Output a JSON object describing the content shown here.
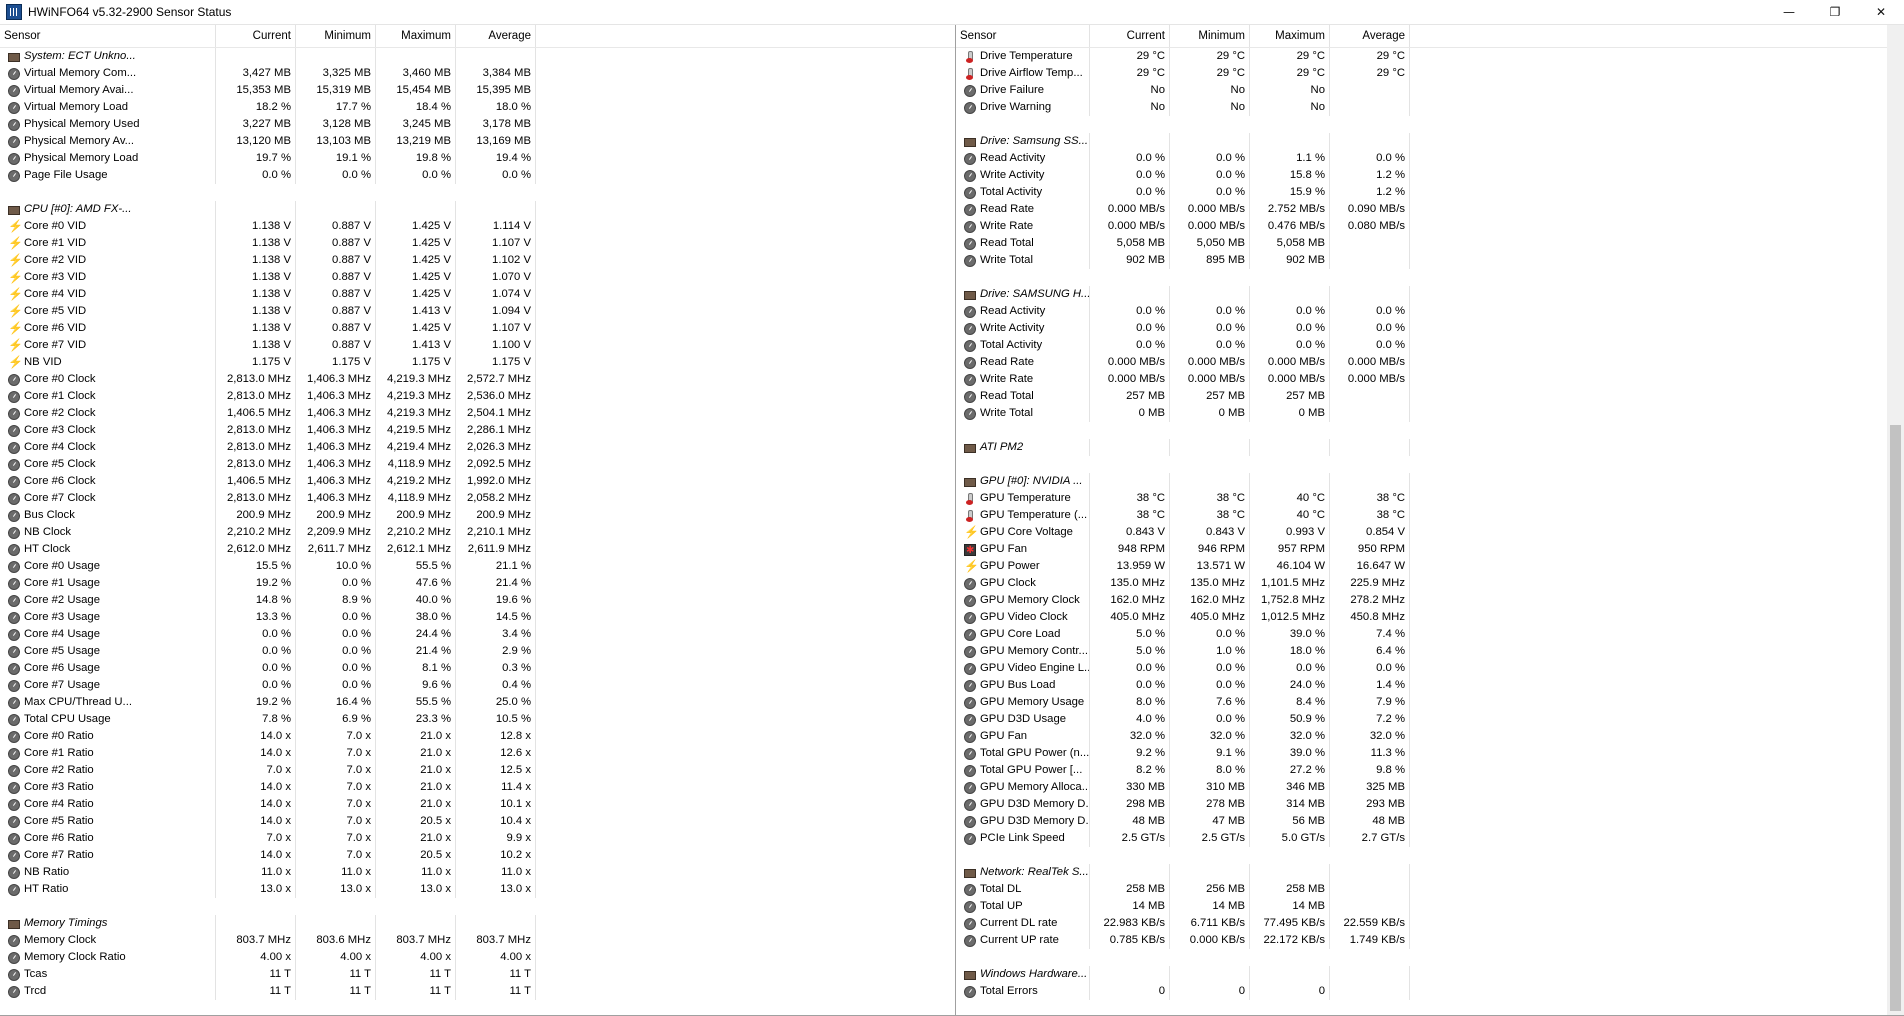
{
  "window": {
    "title": "HWiNFO64 v5.32-2900 Sensor Status",
    "controls": [
      "—",
      "❐",
      "✕"
    ]
  },
  "columns": [
    "Sensor",
    "Current",
    "Minimum",
    "Maximum",
    "Average"
  ],
  "left": [
    {
      "type": "group",
      "name": "System: ECT Unkno...",
      "icon": "chip-icon"
    },
    {
      "type": "row",
      "name": "Virtual Memory Com...",
      "icon": "gauge-icon",
      "v": [
        "3,427 MB",
        "3,325 MB",
        "3,460 MB",
        "3,384 MB"
      ]
    },
    {
      "type": "row",
      "name": "Virtual Memory Avai...",
      "icon": "gauge-icon",
      "v": [
        "15,353 MB",
        "15,319 MB",
        "15,454 MB",
        "15,395 MB"
      ]
    },
    {
      "type": "row",
      "name": "Virtual Memory Load",
      "icon": "gauge-icon",
      "v": [
        "18.2 %",
        "17.7 %",
        "18.4 %",
        "18.0 %"
      ]
    },
    {
      "type": "row",
      "name": "Physical Memory Used",
      "icon": "gauge-icon",
      "v": [
        "3,227 MB",
        "3,128 MB",
        "3,245 MB",
        "3,178 MB"
      ]
    },
    {
      "type": "row",
      "name": "Physical Memory Av...",
      "icon": "gauge-icon",
      "v": [
        "13,120 MB",
        "13,103 MB",
        "13,219 MB",
        "13,169 MB"
      ]
    },
    {
      "type": "row",
      "name": "Physical Memory Load",
      "icon": "gauge-icon",
      "v": [
        "19.7 %",
        "19.1 %",
        "19.8 %",
        "19.4 %"
      ]
    },
    {
      "type": "row",
      "name": "Page File Usage",
      "icon": "gauge-icon",
      "v": [
        "0.0 %",
        "0.0 %",
        "0.0 %",
        "0.0 %"
      ]
    },
    {
      "type": "blank"
    },
    {
      "type": "group",
      "name": "CPU [#0]: AMD FX-...",
      "icon": "chip-icon"
    },
    {
      "type": "row",
      "name": "Core #0 VID",
      "icon": "volt-icon",
      "v": [
        "1.138 V",
        "0.887 V",
        "1.425 V",
        "1.114 V"
      ]
    },
    {
      "type": "row",
      "name": "Core #1 VID",
      "icon": "volt-icon",
      "v": [
        "1.138 V",
        "0.887 V",
        "1.425 V",
        "1.107 V"
      ]
    },
    {
      "type": "row",
      "name": "Core #2 VID",
      "icon": "volt-icon",
      "v": [
        "1.138 V",
        "0.887 V",
        "1.425 V",
        "1.102 V"
      ]
    },
    {
      "type": "row",
      "name": "Core #3 VID",
      "icon": "volt-icon",
      "v": [
        "1.138 V",
        "0.887 V",
        "1.425 V",
        "1.070 V"
      ]
    },
    {
      "type": "row",
      "name": "Core #4 VID",
      "icon": "volt-icon",
      "v": [
        "1.138 V",
        "0.887 V",
        "1.425 V",
        "1.074 V"
      ]
    },
    {
      "type": "row",
      "name": "Core #5 VID",
      "icon": "volt-icon",
      "v": [
        "1.138 V",
        "0.887 V",
        "1.413 V",
        "1.094 V"
      ]
    },
    {
      "type": "row",
      "name": "Core #6 VID",
      "icon": "volt-icon",
      "v": [
        "1.138 V",
        "0.887 V",
        "1.425 V",
        "1.107 V"
      ]
    },
    {
      "type": "row",
      "name": "Core #7 VID",
      "icon": "volt-icon",
      "v": [
        "1.138 V",
        "0.887 V",
        "1.413 V",
        "1.100 V"
      ]
    },
    {
      "type": "row",
      "name": "NB VID",
      "icon": "volt-icon",
      "v": [
        "1.175 V",
        "1.175 V",
        "1.175 V",
        "1.175 V"
      ]
    },
    {
      "type": "row",
      "name": "Core #0 Clock",
      "icon": "gauge-icon",
      "v": [
        "2,813.0 MHz",
        "1,406.3 MHz",
        "4,219.3 MHz",
        "2,572.7 MHz"
      ]
    },
    {
      "type": "row",
      "name": "Core #1 Clock",
      "icon": "gauge-icon",
      "v": [
        "2,813.0 MHz",
        "1,406.3 MHz",
        "4,219.3 MHz",
        "2,536.0 MHz"
      ]
    },
    {
      "type": "row",
      "name": "Core #2 Clock",
      "icon": "gauge-icon",
      "v": [
        "1,406.5 MHz",
        "1,406.3 MHz",
        "4,219.3 MHz",
        "2,504.1 MHz"
      ]
    },
    {
      "type": "row",
      "name": "Core #3 Clock",
      "icon": "gauge-icon",
      "v": [
        "2,813.0 MHz",
        "1,406.3 MHz",
        "4,219.5 MHz",
        "2,286.1 MHz"
      ]
    },
    {
      "type": "row",
      "name": "Core #4 Clock",
      "icon": "gauge-icon",
      "v": [
        "2,813.0 MHz",
        "1,406.3 MHz",
        "4,219.4 MHz",
        "2,026.3 MHz"
      ]
    },
    {
      "type": "row",
      "name": "Core #5 Clock",
      "icon": "gauge-icon",
      "v": [
        "2,813.0 MHz",
        "1,406.3 MHz",
        "4,118.9 MHz",
        "2,092.5 MHz"
      ]
    },
    {
      "type": "row",
      "name": "Core #6 Clock",
      "icon": "gauge-icon",
      "v": [
        "1,406.5 MHz",
        "1,406.3 MHz",
        "4,219.2 MHz",
        "1,992.0 MHz"
      ]
    },
    {
      "type": "row",
      "name": "Core #7 Clock",
      "icon": "gauge-icon",
      "v": [
        "2,813.0 MHz",
        "1,406.3 MHz",
        "4,118.9 MHz",
        "2,058.2 MHz"
      ]
    },
    {
      "type": "row",
      "name": "Bus Clock",
      "icon": "gauge-icon",
      "v": [
        "200.9 MHz",
        "200.9 MHz",
        "200.9 MHz",
        "200.9 MHz"
      ]
    },
    {
      "type": "row",
      "name": "NB Clock",
      "icon": "gauge-icon",
      "v": [
        "2,210.2 MHz",
        "2,209.9 MHz",
        "2,210.2 MHz",
        "2,210.1 MHz"
      ]
    },
    {
      "type": "row",
      "name": "HT Clock",
      "icon": "gauge-icon",
      "v": [
        "2,612.0 MHz",
        "2,611.7 MHz",
        "2,612.1 MHz",
        "2,611.9 MHz"
      ]
    },
    {
      "type": "row",
      "name": "Core #0 Usage",
      "icon": "gauge-icon",
      "v": [
        "15.5 %",
        "10.0 %",
        "55.5 %",
        "21.1 %"
      ]
    },
    {
      "type": "row",
      "name": "Core #1 Usage",
      "icon": "gauge-icon",
      "v": [
        "19.2 %",
        "0.0 %",
        "47.6 %",
        "21.4 %"
      ]
    },
    {
      "type": "row",
      "name": "Core #2 Usage",
      "icon": "gauge-icon",
      "v": [
        "14.8 %",
        "8.9 %",
        "40.0 %",
        "19.6 %"
      ]
    },
    {
      "type": "row",
      "name": "Core #3 Usage",
      "icon": "gauge-icon",
      "v": [
        "13.3 %",
        "0.0 %",
        "38.0 %",
        "14.5 %"
      ]
    },
    {
      "type": "row",
      "name": "Core #4 Usage",
      "icon": "gauge-icon",
      "v": [
        "0.0 %",
        "0.0 %",
        "24.4 %",
        "3.4 %"
      ]
    },
    {
      "type": "row",
      "name": "Core #5 Usage",
      "icon": "gauge-icon",
      "v": [
        "0.0 %",
        "0.0 %",
        "21.4 %",
        "2.9 %"
      ]
    },
    {
      "type": "row",
      "name": "Core #6 Usage",
      "icon": "gauge-icon",
      "v": [
        "0.0 %",
        "0.0 %",
        "8.1 %",
        "0.3 %"
      ]
    },
    {
      "type": "row",
      "name": "Core #7 Usage",
      "icon": "gauge-icon",
      "v": [
        "0.0 %",
        "0.0 %",
        "9.6 %",
        "0.4 %"
      ]
    },
    {
      "type": "row",
      "name": "Max CPU/Thread U...",
      "icon": "gauge-icon",
      "v": [
        "19.2 %",
        "16.4 %",
        "55.5 %",
        "25.0 %"
      ]
    },
    {
      "type": "row",
      "name": "Total CPU Usage",
      "icon": "gauge-icon",
      "v": [
        "7.8 %",
        "6.9 %",
        "23.3 %",
        "10.5 %"
      ]
    },
    {
      "type": "row",
      "name": "Core #0 Ratio",
      "icon": "gauge-icon",
      "v": [
        "14.0 x",
        "7.0 x",
        "21.0 x",
        "12.8 x"
      ]
    },
    {
      "type": "row",
      "name": "Core #1 Ratio",
      "icon": "gauge-icon",
      "v": [
        "14.0 x",
        "7.0 x",
        "21.0 x",
        "12.6 x"
      ]
    },
    {
      "type": "row",
      "name": "Core #2 Ratio",
      "icon": "gauge-icon",
      "v": [
        "7.0 x",
        "7.0 x",
        "21.0 x",
        "12.5 x"
      ]
    },
    {
      "type": "row",
      "name": "Core #3 Ratio",
      "icon": "gauge-icon",
      "v": [
        "14.0 x",
        "7.0 x",
        "21.0 x",
        "11.4 x"
      ]
    },
    {
      "type": "row",
      "name": "Core #4 Ratio",
      "icon": "gauge-icon",
      "v": [
        "14.0 x",
        "7.0 x",
        "21.0 x",
        "10.1 x"
      ]
    },
    {
      "type": "row",
      "name": "Core #5 Ratio",
      "icon": "gauge-icon",
      "v": [
        "14.0 x",
        "7.0 x",
        "20.5 x",
        "10.4 x"
      ]
    },
    {
      "type": "row",
      "name": "Core #6 Ratio",
      "icon": "gauge-icon",
      "v": [
        "7.0 x",
        "7.0 x",
        "21.0 x",
        "9.9 x"
      ]
    },
    {
      "type": "row",
      "name": "Core #7 Ratio",
      "icon": "gauge-icon",
      "v": [
        "14.0 x",
        "7.0 x",
        "20.5 x",
        "10.2 x"
      ]
    },
    {
      "type": "row",
      "name": "NB Ratio",
      "icon": "gauge-icon",
      "v": [
        "11.0 x",
        "11.0 x",
        "11.0 x",
        "11.0 x"
      ]
    },
    {
      "type": "row",
      "name": "HT Ratio",
      "icon": "gauge-icon",
      "v": [
        "13.0 x",
        "13.0 x",
        "13.0 x",
        "13.0 x"
      ]
    },
    {
      "type": "blank"
    },
    {
      "type": "group",
      "name": "Memory Timings",
      "icon": "chip-icon"
    },
    {
      "type": "row",
      "name": "Memory Clock",
      "icon": "gauge-icon",
      "v": [
        "803.7 MHz",
        "803.6 MHz",
        "803.7 MHz",
        "803.7 MHz"
      ]
    },
    {
      "type": "row",
      "name": "Memory Clock Ratio",
      "icon": "gauge-icon",
      "v": [
        "4.00 x",
        "4.00 x",
        "4.00 x",
        "4.00 x"
      ]
    },
    {
      "type": "row",
      "name": "Tcas",
      "icon": "gauge-icon",
      "v": [
        "11 T",
        "11 T",
        "11 T",
        "11 T"
      ]
    },
    {
      "type": "row",
      "name": "Trcd",
      "icon": "gauge-icon",
      "v": [
        "11 T",
        "11 T",
        "11 T",
        "11 T"
      ]
    }
  ],
  "right": [
    {
      "type": "row",
      "name": "Drive Temperature",
      "icon": "temp-icon",
      "v": [
        "29 °C",
        "29 °C",
        "29 °C",
        "29 °C"
      ]
    },
    {
      "type": "row",
      "name": "Drive Airflow Temp...",
      "icon": "temp-icon",
      "v": [
        "29 °C",
        "29 °C",
        "29 °C",
        "29 °C"
      ]
    },
    {
      "type": "row",
      "name": "Drive Failure",
      "icon": "gauge-icon",
      "v": [
        "No",
        "No",
        "No",
        ""
      ]
    },
    {
      "type": "row",
      "name": "Drive Warning",
      "icon": "gauge-icon",
      "v": [
        "No",
        "No",
        "No",
        ""
      ]
    },
    {
      "type": "blank"
    },
    {
      "type": "group",
      "name": "Drive: Samsung SS...",
      "icon": "chip-icon"
    },
    {
      "type": "row",
      "name": "Read Activity",
      "icon": "gauge-icon",
      "v": [
        "0.0 %",
        "0.0 %",
        "1.1 %",
        "0.0 %"
      ]
    },
    {
      "type": "row",
      "name": "Write Activity",
      "icon": "gauge-icon",
      "v": [
        "0.0 %",
        "0.0 %",
        "15.8 %",
        "1.2 %"
      ]
    },
    {
      "type": "row",
      "name": "Total Activity",
      "icon": "gauge-icon",
      "v": [
        "0.0 %",
        "0.0 %",
        "15.9 %",
        "1.2 %"
      ]
    },
    {
      "type": "row",
      "name": "Read Rate",
      "icon": "gauge-icon",
      "v": [
        "0.000 MB/s",
        "0.000 MB/s",
        "2.752 MB/s",
        "0.090 MB/s"
      ]
    },
    {
      "type": "row",
      "name": "Write Rate",
      "icon": "gauge-icon",
      "v": [
        "0.000 MB/s",
        "0.000 MB/s",
        "0.476 MB/s",
        "0.080 MB/s"
      ]
    },
    {
      "type": "row",
      "name": "Read Total",
      "icon": "gauge-icon",
      "v": [
        "5,058 MB",
        "5,050 MB",
        "5,058 MB",
        ""
      ]
    },
    {
      "type": "row",
      "name": "Write Total",
      "icon": "gauge-icon",
      "v": [
        "902 MB",
        "895 MB",
        "902 MB",
        ""
      ]
    },
    {
      "type": "blank"
    },
    {
      "type": "group",
      "name": "Drive: SAMSUNG H...",
      "icon": "chip-icon"
    },
    {
      "type": "row",
      "name": "Read Activity",
      "icon": "gauge-icon",
      "v": [
        "0.0 %",
        "0.0 %",
        "0.0 %",
        "0.0 %"
      ]
    },
    {
      "type": "row",
      "name": "Write Activity",
      "icon": "gauge-icon",
      "v": [
        "0.0 %",
        "0.0 %",
        "0.0 %",
        "0.0 %"
      ]
    },
    {
      "type": "row",
      "name": "Total Activity",
      "icon": "gauge-icon",
      "v": [
        "0.0 %",
        "0.0 %",
        "0.0 %",
        "0.0 %"
      ]
    },
    {
      "type": "row",
      "name": "Read Rate",
      "icon": "gauge-icon",
      "v": [
        "0.000 MB/s",
        "0.000 MB/s",
        "0.000 MB/s",
        "0.000 MB/s"
      ]
    },
    {
      "type": "row",
      "name": "Write Rate",
      "icon": "gauge-icon",
      "v": [
        "0.000 MB/s",
        "0.000 MB/s",
        "0.000 MB/s",
        "0.000 MB/s"
      ]
    },
    {
      "type": "row",
      "name": "Read Total",
      "icon": "gauge-icon",
      "v": [
        "257 MB",
        "257 MB",
        "257 MB",
        ""
      ]
    },
    {
      "type": "row",
      "name": "Write Total",
      "icon": "gauge-icon",
      "v": [
        "0 MB",
        "0 MB",
        "0 MB",
        ""
      ]
    },
    {
      "type": "blank"
    },
    {
      "type": "group",
      "name": "ATI PM2",
      "icon": "chip-icon"
    },
    {
      "type": "blank"
    },
    {
      "type": "group",
      "name": "GPU [#0]: NVIDIA ...",
      "icon": "chip-icon"
    },
    {
      "type": "row",
      "name": "GPU Temperature",
      "icon": "temp-icon",
      "v": [
        "38 °C",
        "38 °C",
        "40 °C",
        "38 °C"
      ]
    },
    {
      "type": "row",
      "name": "GPU Temperature (...",
      "icon": "temp-icon",
      "v": [
        "38 °C",
        "38 °C",
        "40 °C",
        "38 °C"
      ]
    },
    {
      "type": "row",
      "name": "GPU Core Voltage",
      "icon": "volt-icon",
      "v": [
        "0.843 V",
        "0.843 V",
        "0.993 V",
        "0.854 V"
      ]
    },
    {
      "type": "row",
      "name": "GPU Fan",
      "icon": "fan-icon",
      "v": [
        "948 RPM",
        "946 RPM",
        "957 RPM",
        "950 RPM"
      ]
    },
    {
      "type": "row",
      "name": "GPU Power",
      "icon": "volt-icon",
      "v": [
        "13.959 W",
        "13.571 W",
        "46.104 W",
        "16.647 W"
      ]
    },
    {
      "type": "row",
      "name": "GPU Clock",
      "icon": "gauge-icon",
      "v": [
        "135.0 MHz",
        "135.0 MHz",
        "1,101.5 MHz",
        "225.9 MHz"
      ]
    },
    {
      "type": "row",
      "name": "GPU Memory Clock",
      "icon": "gauge-icon",
      "v": [
        "162.0 MHz",
        "162.0 MHz",
        "1,752.8 MHz",
        "278.2 MHz"
      ]
    },
    {
      "type": "row",
      "name": "GPU Video Clock",
      "icon": "gauge-icon",
      "v": [
        "405.0 MHz",
        "405.0 MHz",
        "1,012.5 MHz",
        "450.8 MHz"
      ]
    },
    {
      "type": "row",
      "name": "GPU Core Load",
      "icon": "gauge-icon",
      "v": [
        "5.0 %",
        "0.0 %",
        "39.0 %",
        "7.4 %"
      ]
    },
    {
      "type": "row",
      "name": "GPU Memory Contr...",
      "icon": "gauge-icon",
      "v": [
        "5.0 %",
        "1.0 %",
        "18.0 %",
        "6.4 %"
      ]
    },
    {
      "type": "row",
      "name": "GPU Video Engine L...",
      "icon": "gauge-icon",
      "v": [
        "0.0 %",
        "0.0 %",
        "0.0 %",
        "0.0 %"
      ]
    },
    {
      "type": "row",
      "name": "GPU Bus Load",
      "icon": "gauge-icon",
      "v": [
        "0.0 %",
        "0.0 %",
        "24.0 %",
        "1.4 %"
      ]
    },
    {
      "type": "row",
      "name": "GPU Memory Usage",
      "icon": "gauge-icon",
      "v": [
        "8.0 %",
        "7.6 %",
        "8.4 %",
        "7.9 %"
      ]
    },
    {
      "type": "row",
      "name": "GPU D3D Usage",
      "icon": "gauge-icon",
      "v": [
        "4.0 %",
        "0.0 %",
        "50.9 %",
        "7.2 %"
      ]
    },
    {
      "type": "row",
      "name": "GPU Fan",
      "icon": "gauge-icon",
      "v": [
        "32.0 %",
        "32.0 %",
        "32.0 %",
        "32.0 %"
      ]
    },
    {
      "type": "row",
      "name": "Total GPU Power (n...",
      "icon": "gauge-icon",
      "v": [
        "9.2 %",
        "9.1 %",
        "39.0 %",
        "11.3 %"
      ]
    },
    {
      "type": "row",
      "name": "Total GPU Power [...",
      "icon": "gauge-icon",
      "v": [
        "8.2 %",
        "8.0 %",
        "27.2 %",
        "9.8 %"
      ]
    },
    {
      "type": "row",
      "name": "GPU Memory Alloca...",
      "icon": "gauge-icon",
      "v": [
        "330 MB",
        "310 MB",
        "346 MB",
        "325 MB"
      ]
    },
    {
      "type": "row",
      "name": "GPU D3D Memory D...",
      "icon": "gauge-icon",
      "v": [
        "298 MB",
        "278 MB",
        "314 MB",
        "293 MB"
      ]
    },
    {
      "type": "row",
      "name": "GPU D3D Memory D...",
      "icon": "gauge-icon",
      "v": [
        "48 MB",
        "47 MB",
        "56 MB",
        "48 MB"
      ]
    },
    {
      "type": "row",
      "name": "PCIe Link Speed",
      "icon": "gauge-icon",
      "v": [
        "2.5 GT/s",
        "2.5 GT/s",
        "5.0 GT/s",
        "2.7 GT/s"
      ]
    },
    {
      "type": "blank"
    },
    {
      "type": "group",
      "name": "Network: RealTek S...",
      "icon": "chip-icon"
    },
    {
      "type": "row",
      "name": "Total DL",
      "icon": "gauge-icon",
      "v": [
        "258 MB",
        "256 MB",
        "258 MB",
        ""
      ]
    },
    {
      "type": "row",
      "name": "Total UP",
      "icon": "gauge-icon",
      "v": [
        "14 MB",
        "14 MB",
        "14 MB",
        ""
      ]
    },
    {
      "type": "row",
      "name": "Current DL rate",
      "icon": "gauge-icon",
      "v": [
        "22.983 KB/s",
        "6.711 KB/s",
        "77.495 KB/s",
        "22.559 KB/s"
      ]
    },
    {
      "type": "row",
      "name": "Current UP rate",
      "icon": "gauge-icon",
      "v": [
        "0.785 KB/s",
        "0.000 KB/s",
        "22.172 KB/s",
        "1.749 KB/s"
      ]
    },
    {
      "type": "blank"
    },
    {
      "type": "group",
      "name": "Windows Hardware...",
      "icon": "chip-icon"
    },
    {
      "type": "row",
      "name": "Total Errors",
      "icon": "gauge-icon",
      "v": [
        "0",
        "0",
        "0",
        ""
      ]
    }
  ]
}
